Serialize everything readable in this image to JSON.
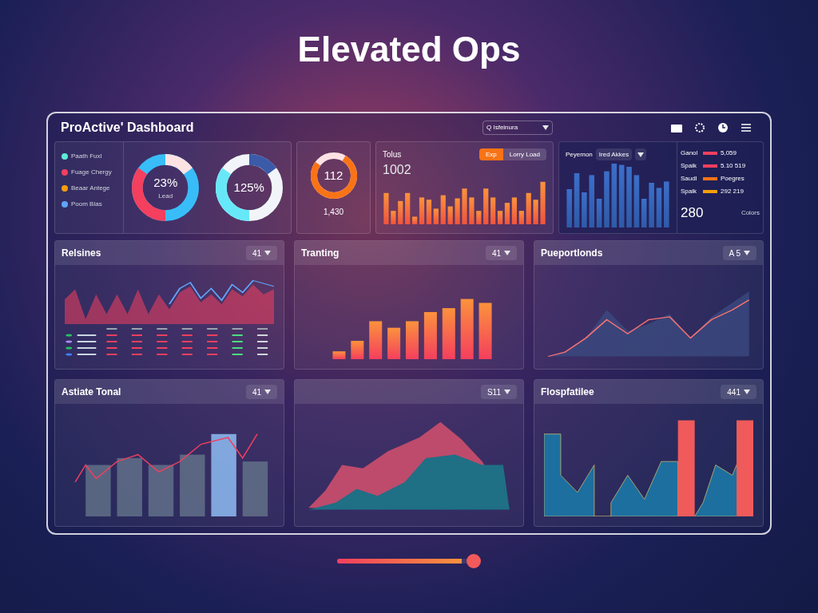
{
  "headline": "Elevated Ops",
  "window": {
    "title": "ProActive' Dashboard",
    "search": {
      "value": "Q  Isfeinura"
    }
  },
  "summary": {
    "legend": [
      {
        "label": "Paath Fuxl",
        "color": "#5eead4"
      },
      {
        "label": "Fuage Chergy",
        "color": "#f43f5e"
      },
      {
        "label": "Beaar Antege",
        "color": "#f59e0b"
      },
      {
        "label": "Poom Blas",
        "color": "#60a5fa"
      }
    ],
    "donuts": [
      {
        "value": "23%",
        "caption": "Lead"
      },
      {
        "value": "125%"
      }
    ],
    "gauge": {
      "value": "112",
      "caption": "1,430"
    }
  },
  "totals": {
    "title": "Tolus",
    "value": "1002",
    "toggle": [
      {
        "label": "Exp",
        "selected": true
      },
      {
        "label": "Lorry Load",
        "selected": false
      }
    ]
  },
  "revenue": {
    "legend": "Peyemon",
    "filter": "Ired Akkes",
    "rows": [
      {
        "label": "Ganol",
        "value": "5,059",
        "color": "#f43f5e"
      },
      {
        "label": "Spaik",
        "value": "5.10 519",
        "color": "#f43f5e"
      },
      {
        "label": "Saudl",
        "value": "Poegres",
        "color": "#f97316"
      },
      {
        "label": "Spaik",
        "value": "292 219",
        "color": "#f59e0b"
      }
    ],
    "total": "280",
    "total_label": "Colors"
  },
  "panels": [
    {
      "title": "Relsines",
      "selector": "41",
      "kind": "wave"
    },
    {
      "title": "Tranting",
      "selector": "41",
      "kind": "bars"
    },
    {
      "title": "Pueportlonds",
      "selector": "A 5",
      "kind": "lines"
    },
    {
      "title": "Astiate Tonal",
      "selector": "41",
      "kind": "columns"
    },
    {
      "selector": "S11",
      "kind": "area"
    },
    {
      "title": "Flospfatilee",
      "selector": "441",
      "kind": "steps"
    }
  ],
  "slider": {
    "level": 0.96
  }
}
